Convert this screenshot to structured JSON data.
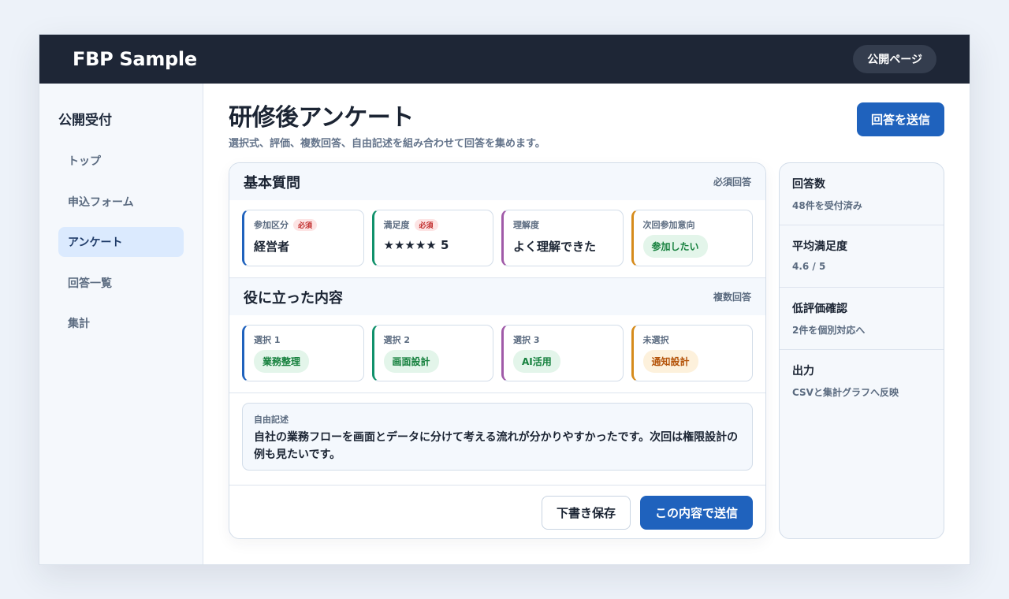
{
  "header": {
    "brand": "FBP Sample",
    "public_page_label": "公開ページ"
  },
  "sidebar": {
    "title": "公開受付",
    "items": [
      {
        "label": "トップ"
      },
      {
        "label": "申込フォーム"
      },
      {
        "label": "アンケート",
        "active": true
      },
      {
        "label": "回答一覧"
      },
      {
        "label": "集計"
      }
    ]
  },
  "page": {
    "title": "研修後アンケート",
    "subtitle": "選択式、評価、複数回答、自由記述を組み合わせて回答を集めます。",
    "submit_label": "回答を送信"
  },
  "basic": {
    "title": "基本質問",
    "note": "必須回答",
    "questions": [
      {
        "label": "参加区分",
        "required": "必須",
        "value": "経営者"
      },
      {
        "label": "満足度",
        "required": "必須",
        "value": "★★★★★ 5"
      },
      {
        "label": "理解度",
        "value": "よく理解できた"
      },
      {
        "label": "次回参加意向",
        "pill": "参加したい"
      }
    ]
  },
  "useful": {
    "title": "役に立った内容",
    "note": "複数回答",
    "options": [
      {
        "label": "選択 1",
        "pill": "業務整理"
      },
      {
        "label": "選択 2",
        "pill": "画面設計"
      },
      {
        "label": "選択 3",
        "pill": "AI活用"
      },
      {
        "label": "未選択",
        "pill": "通知設計"
      }
    ]
  },
  "free": {
    "label": "自由記述",
    "text": "自社の業務フローを画面とデータに分けて考える流れが分かりやすかったです。次回は権限設計の例も見たいです。"
  },
  "actions": {
    "draft_label": "下書き保存",
    "send_label": "この内容で送信"
  },
  "stats": [
    {
      "title": "回答数",
      "value": "48件を受付済み"
    },
    {
      "title": "平均満足度",
      "value": "4.6 / 5"
    },
    {
      "title": "低評価確認",
      "value": "2件を個別対応へ"
    },
    {
      "title": "出力",
      "value": "CSVと集計グラフへ反映"
    }
  ]
}
